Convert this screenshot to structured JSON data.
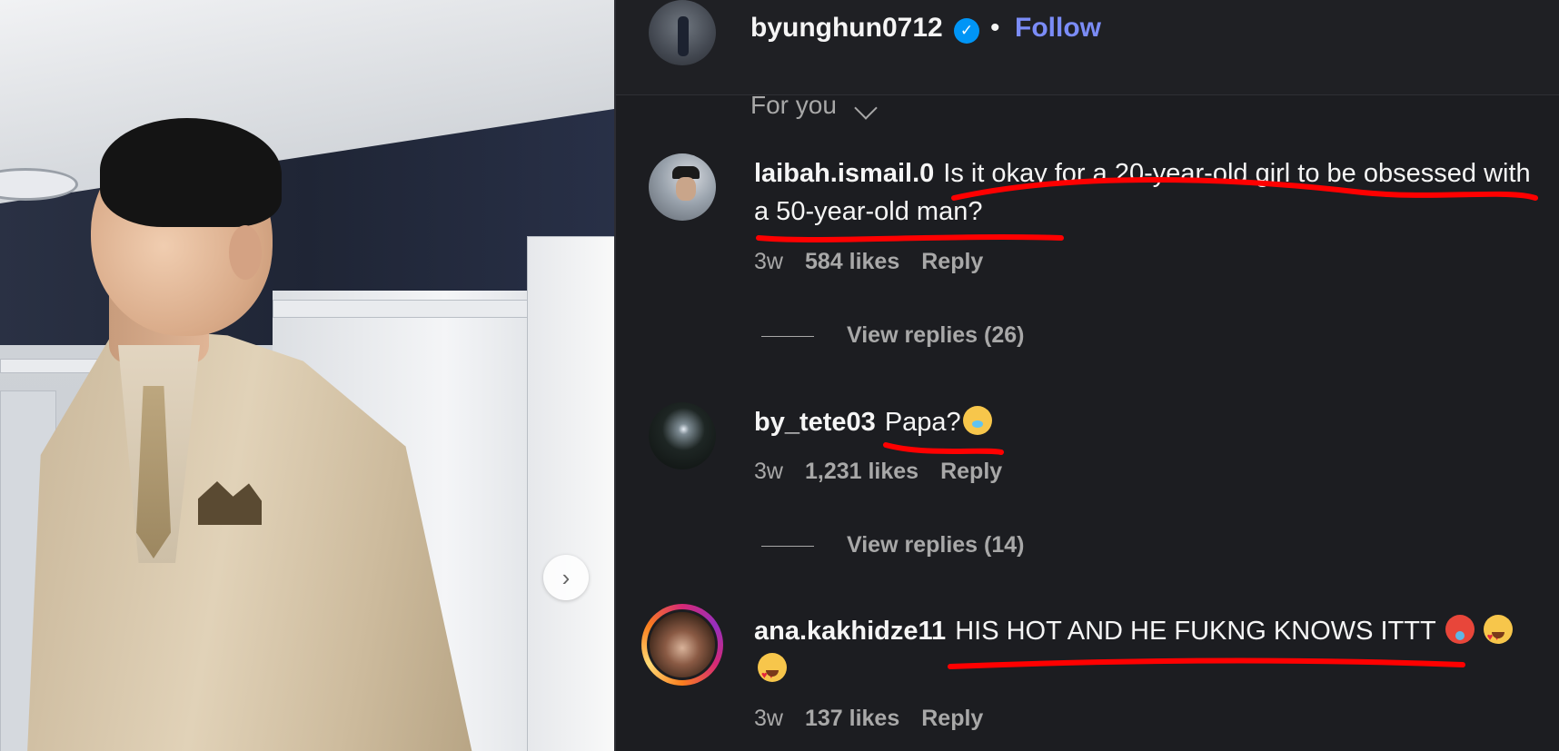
{
  "post": {
    "username": "byunghun0712",
    "separator": "•",
    "follow_label": "Follow",
    "next_arrow": "›"
  },
  "sort": {
    "label": "For you"
  },
  "comments": [
    {
      "username": "laibah.ismail.0",
      "text": "Is it okay for a 20-year-old girl to be obsessed with a 50-year-old man?",
      "time": "3w",
      "likes": "584 likes",
      "reply": "Reply",
      "view_replies": "View replies (26)"
    },
    {
      "username": "by_tete03",
      "text": "Papa?",
      "time": "3w",
      "likes": "1,231 likes",
      "reply": "Reply",
      "view_replies": "View replies (14)"
    },
    {
      "username": "ana.kakhidze11",
      "text": "HIS HOT AND HE FUKNG KNOWS ITTT",
      "time": "3w",
      "likes": "137 likes",
      "reply": "Reply"
    }
  ],
  "colors": {
    "background": "#1c1d21",
    "follow": "#7b8cf7",
    "verified": "#0095f6",
    "annotation": "#ff0000"
  },
  "icons": [
    "verified-badge-icon",
    "chevron-down-icon",
    "chevron-right-icon",
    "emoji-icons"
  ]
}
